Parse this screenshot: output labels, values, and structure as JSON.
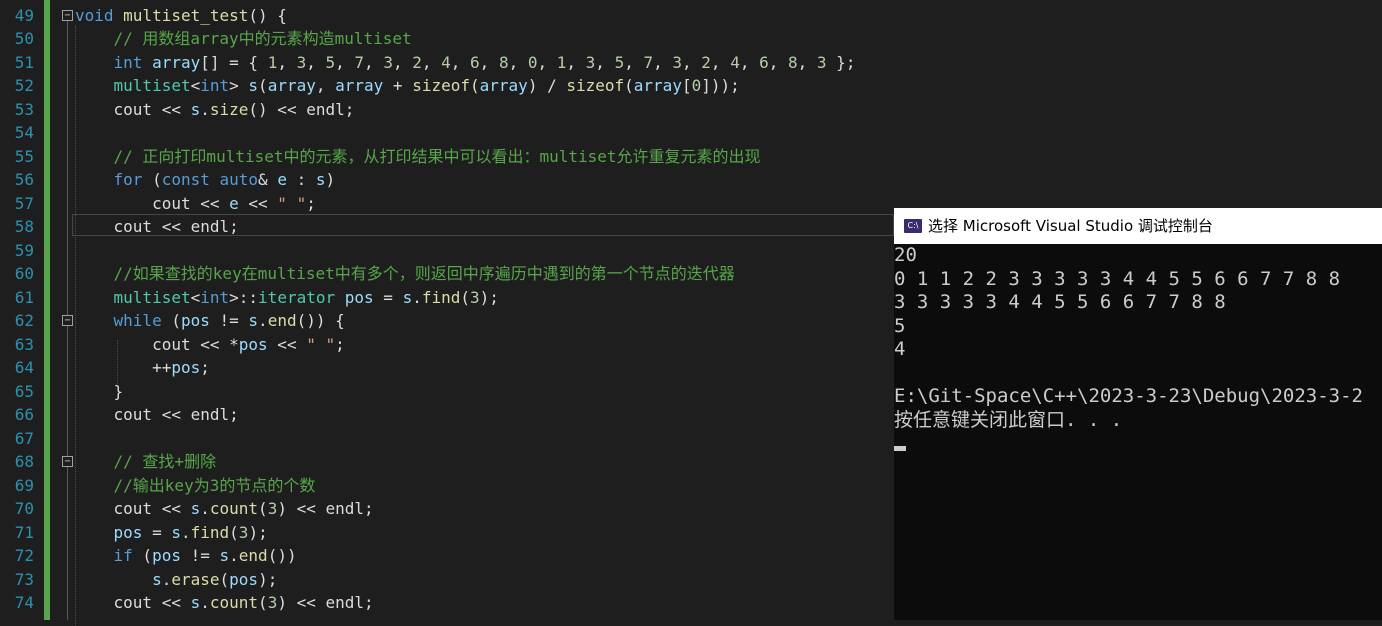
{
  "editor": {
    "line_numbers": [
      "49",
      "50",
      "51",
      "52",
      "53",
      "54",
      "55",
      "56",
      "57",
      "58",
      "59",
      "60",
      "61",
      "62",
      "63",
      "64",
      "65",
      "66",
      "67",
      "68",
      "69",
      "70",
      "71",
      "72",
      "73",
      "74"
    ],
    "lines": [
      "void multiset_test() {",
      "    // 用数组array中的元素构造multiset",
      "    int array[] = { 1, 3, 5, 7, 3, 2, 4, 6, 8, 0, 1, 3, 5, 7, 3, 2, 4, 6, 8, 3 };",
      "    multiset<int> s(array, array + sizeof(array) / sizeof(array[0]));",
      "    cout << s.size() << endl;",
      "",
      "    // 正向打印multiset中的元素，从打印结果中可以看出：multiset允许重复元素的出现",
      "    for (const auto& e : s)",
      "        cout << e << \" \";",
      "    cout << endl;",
      "",
      "    //如果查找的key在multiset中有多个，则返回中序遍历中遇到的第一个节点的迭代器",
      "    multiset<int>::iterator pos = s.find(3);",
      "    while (pos != s.end()) {",
      "        cout << *pos << \" \";",
      "        ++pos;",
      "    }",
      "    cout << endl;",
      "",
      "    // 查找+删除",
      "    //输出key为3的节点的个数",
      "    cout << s.count(3) << endl;",
      "    pos = s.find(3);",
      "    if (pos != s.end())",
      "        s.erase(pos);",
      "    cout << s.count(3) << endl;"
    ],
    "colors": {
      "background": "#1e1e1e",
      "keyword": "#569cd6",
      "comment": "#57a64a",
      "string": "#d69d85",
      "number": "#b5cea8",
      "variable": "#9cdcfe",
      "function": "#dcdcaa",
      "type": "#4ec9b0",
      "line_number": "#2b91af"
    }
  },
  "console": {
    "title": "选择 Microsoft Visual Studio 调试控制台",
    "icon": "console-app-icon",
    "icon_text": "C:\\",
    "output_lines": [
      "20",
      "0 1 1 2 2 3 3 3 3 3 4 4 5 5 6 6 7 7 8 8",
      "3 3 3 3 3 4 4 5 5 6 6 7 7 8 8",
      "5",
      "4",
      "",
      "E:\\Git-Space\\C++\\2023-3-23\\Debug\\2023-3-2",
      "按任意键关闭此窗口. . ."
    ]
  }
}
